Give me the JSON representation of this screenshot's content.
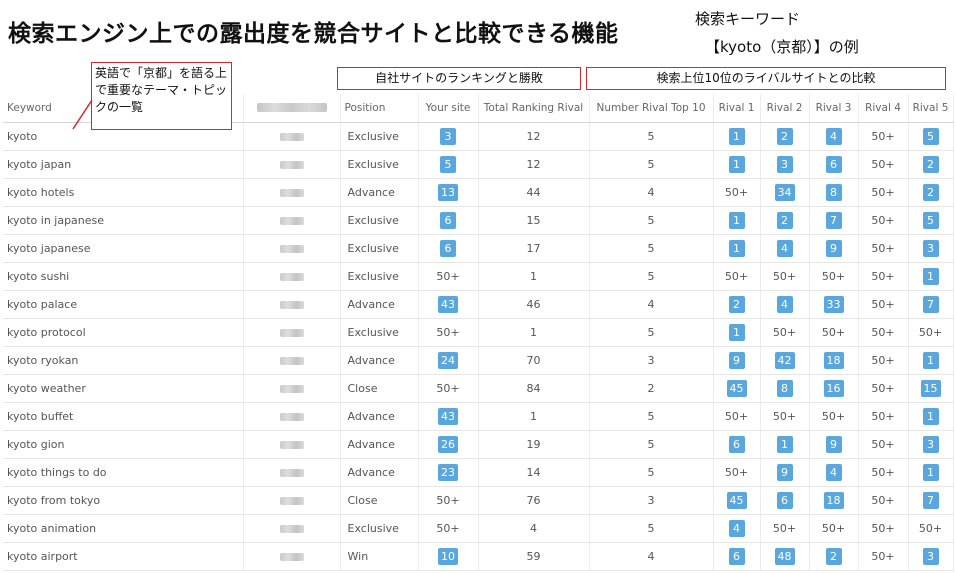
{
  "header": {
    "title": "検索エンジン上での露出度を競合サイトと比較できる機能",
    "keyword_label": "検索キーワード",
    "keyword_value": "【kyoto（京都）】の例"
  },
  "callouts": {
    "topics": "英語で「京都」を語る上で重要なテーマ・トピックの一覧",
    "own_site": "自社サイトのランキングと勝敗",
    "rivals": "検索上位10位のライバルサイトとの比較"
  },
  "colors": {
    "badge": "#5aa7de",
    "callout_border": "#d9262c"
  },
  "table": {
    "columns": [
      "Keyword",
      "",
      "Position",
      "Your site",
      "Total Ranking Rival",
      "Number Rival Top 10",
      "Rival 1",
      "Rival 2",
      "Rival 3",
      "Rival 4",
      "Rival 5"
    ],
    "rows": [
      {
        "keyword": "kyoto",
        "position": "Exclusive",
        "your_site": "3",
        "total": "12",
        "top10": "5",
        "rivals": [
          "1",
          "2",
          "4",
          "50+",
          "5"
        ]
      },
      {
        "keyword": "kyoto japan",
        "position": "Exclusive",
        "your_site": "5",
        "total": "12",
        "top10": "5",
        "rivals": [
          "1",
          "3",
          "6",
          "50+",
          "2"
        ]
      },
      {
        "keyword": "kyoto hotels",
        "position": "Advance",
        "your_site": "13",
        "total": "44",
        "top10": "4",
        "rivals": [
          "50+",
          "34",
          "8",
          "50+",
          "2"
        ]
      },
      {
        "keyword": "kyoto in japanese",
        "position": "Exclusive",
        "your_site": "6",
        "total": "15",
        "top10": "5",
        "rivals": [
          "1",
          "2",
          "7",
          "50+",
          "5"
        ]
      },
      {
        "keyword": "kyoto japanese",
        "position": "Exclusive",
        "your_site": "6",
        "total": "17",
        "top10": "5",
        "rivals": [
          "1",
          "4",
          "9",
          "50+",
          "3"
        ]
      },
      {
        "keyword": "kyoto sushi",
        "position": "Exclusive",
        "your_site": "50+",
        "total": "1",
        "top10": "5",
        "rivals": [
          "50+",
          "50+",
          "50+",
          "50+",
          "1"
        ]
      },
      {
        "keyword": "kyoto palace",
        "position": "Advance",
        "your_site": "43",
        "total": "46",
        "top10": "4",
        "rivals": [
          "2",
          "4",
          "33",
          "50+",
          "7"
        ]
      },
      {
        "keyword": "kyoto protocol",
        "position": "Exclusive",
        "your_site": "50+",
        "total": "1",
        "top10": "5",
        "rivals": [
          "1",
          "50+",
          "50+",
          "50+",
          "50+"
        ]
      },
      {
        "keyword": "kyoto ryokan",
        "position": "Advance",
        "your_site": "24",
        "total": "70",
        "top10": "3",
        "rivals": [
          "9",
          "42",
          "18",
          "50+",
          "1"
        ]
      },
      {
        "keyword": "kyoto weather",
        "position": "Close",
        "your_site": "50+",
        "total": "84",
        "top10": "2",
        "rivals": [
          "45",
          "8",
          "16",
          "50+",
          "15"
        ]
      },
      {
        "keyword": "kyoto buffet",
        "position": "Advance",
        "your_site": "43",
        "total": "1",
        "top10": "5",
        "rivals": [
          "50+",
          "50+",
          "50+",
          "50+",
          "1"
        ]
      },
      {
        "keyword": "kyoto gion",
        "position": "Advance",
        "your_site": "26",
        "total": "19",
        "top10": "5",
        "rivals": [
          "6",
          "1",
          "9",
          "50+",
          "3"
        ]
      },
      {
        "keyword": "kyoto things to do",
        "position": "Advance",
        "your_site": "23",
        "total": "14",
        "top10": "5",
        "rivals": [
          "50+",
          "9",
          "4",
          "50+",
          "1"
        ]
      },
      {
        "keyword": "kyoto from tokyo",
        "position": "Close",
        "your_site": "50+",
        "total": "76",
        "top10": "3",
        "rivals": [
          "45",
          "6",
          "18",
          "50+",
          "7"
        ]
      },
      {
        "keyword": "kyoto animation",
        "position": "Exclusive",
        "your_site": "50+",
        "total": "4",
        "top10": "5",
        "rivals": [
          "4",
          "50+",
          "50+",
          "50+",
          "50+"
        ]
      },
      {
        "keyword": "kyoto airport",
        "position": "Win",
        "your_site": "10",
        "total": "59",
        "top10": "4",
        "rivals": [
          "6",
          "48",
          "2",
          "50+",
          "3"
        ]
      }
    ]
  }
}
